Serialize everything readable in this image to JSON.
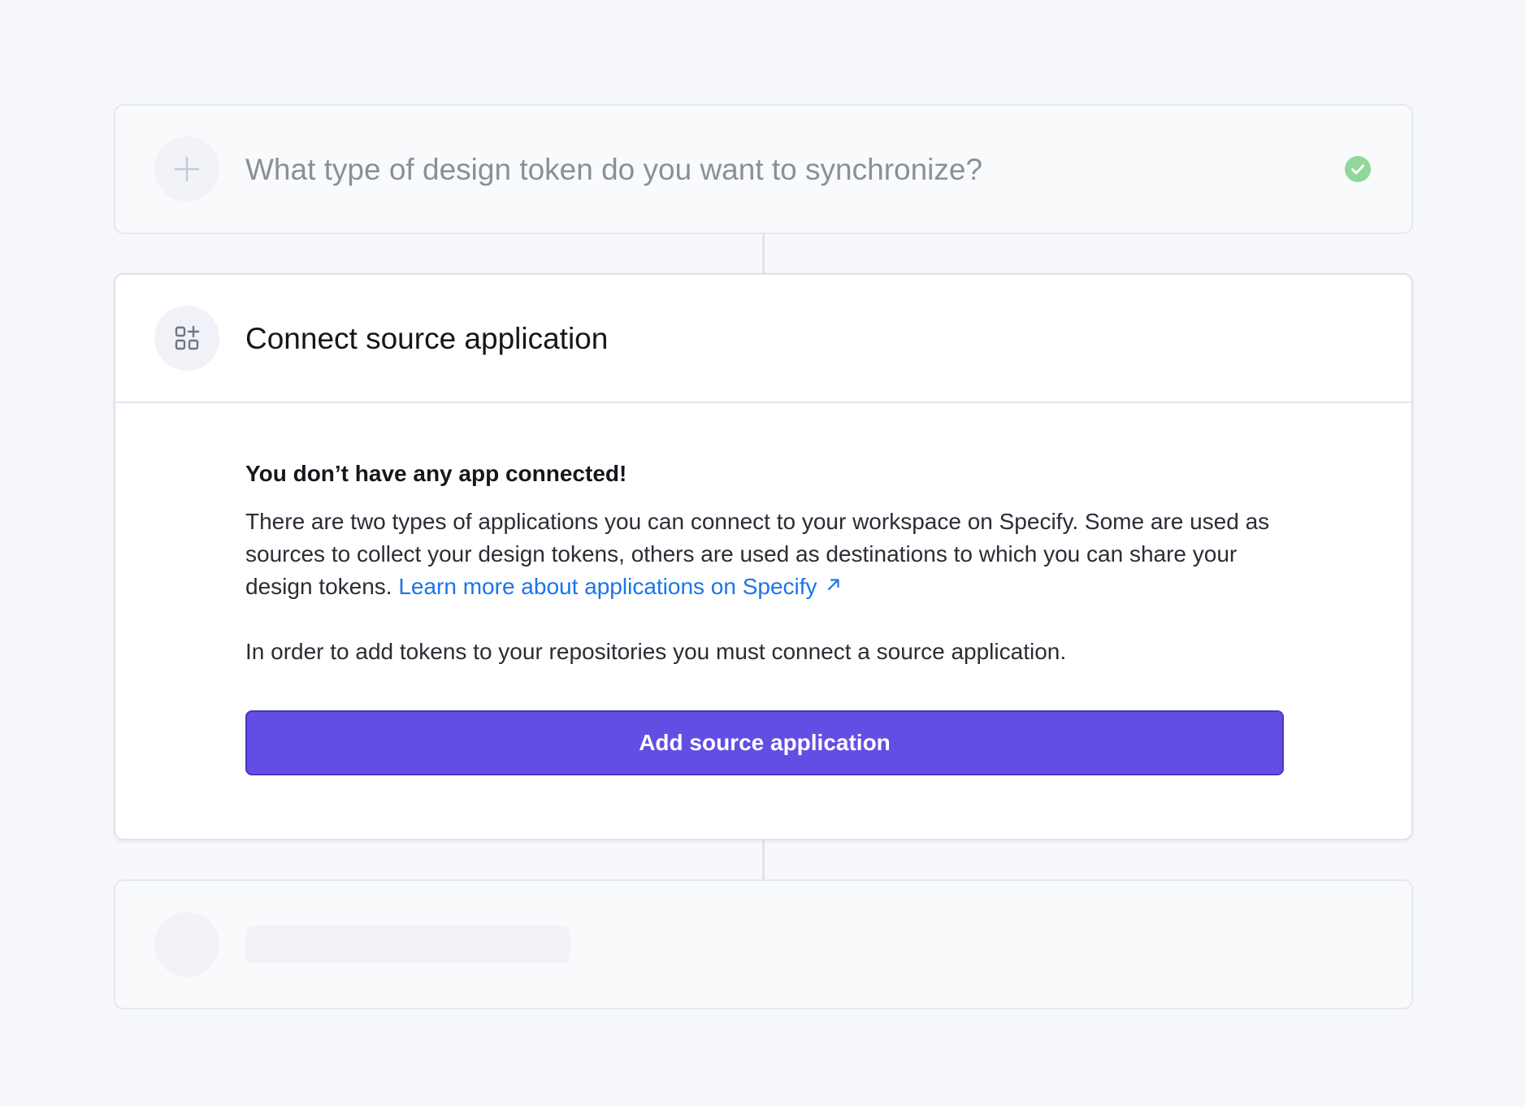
{
  "steps": {
    "step1": {
      "title": "What type of design token do you want to synchronize?",
      "icon": "plus-icon",
      "status_icon": "check-circle-icon",
      "status_color": "#8fd79a"
    },
    "step2": {
      "title": "Connect source application",
      "icon": "apps-add-icon",
      "empty_title": "You don’t have any app connected!",
      "description": "There are two types of applications you can connect to your workspace on Specify. Some are used as sources to collect your design tokens, others are used as destinations to which you can share your design tokens. ",
      "link_label": "Learn more about applications on Specify",
      "link_icon": "external-arrow-icon",
      "note": "In order to add tokens to your repositories you must connect a source application.",
      "button_label": "Add source application"
    },
    "step3": {
      "state": "skeleton"
    }
  },
  "colors": {
    "background": "#f7f8fb",
    "primary_button": "#634ee3",
    "link": "#1b75ea",
    "success": "#8fd79a"
  }
}
